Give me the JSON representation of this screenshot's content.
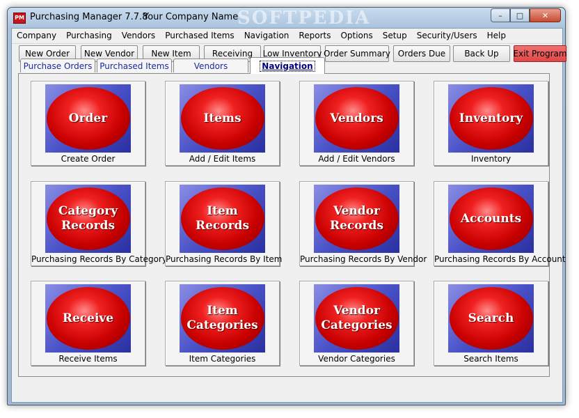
{
  "window": {
    "title": "Purchasing Manager 7.7.8",
    "company": "Your Company Name",
    "watermark": "SOFTPEDIA",
    "controls": {
      "minimize": "–",
      "maximize": "□",
      "close": "✕"
    }
  },
  "menu": [
    "Company",
    "Purchasing",
    "Vendors",
    "Purchased Items",
    "Navigation",
    "Reports",
    "Options",
    "Setup",
    "Security/Users",
    "Help"
  ],
  "toolbar": [
    "New Order",
    "New Vendor",
    "New Item",
    "Receiving",
    "Low Inventory",
    "Order Summary",
    "Orders Due",
    "Back Up",
    "Exit Program"
  ],
  "tabs": [
    "Purchase Orders",
    "Purchased Items",
    "Vendors",
    "Navigation"
  ],
  "active_tab": "Navigation",
  "colors": {
    "accent_exit": "#e85050",
    "tile_blue": "#4a52c8",
    "ball_red": "#e01010"
  },
  "cards": [
    {
      "tile": "Order",
      "label": "Create  Order"
    },
    {
      "tile": "Items",
      "label": "Add / Edit Items"
    },
    {
      "tile": "Vendors",
      "label": "Add / Edit Vendors"
    },
    {
      "tile": "Inventory",
      "label": "Inventory"
    },
    {
      "tile": "Category Records",
      "label": "Purchasing Records By Category"
    },
    {
      "tile": "Item Records",
      "label": "Purchasing Records By Item"
    },
    {
      "tile": "Vendor Records",
      "label": "Purchasing Records By Vendor"
    },
    {
      "tile": "Accounts",
      "label": "Purchasing Records By Account"
    },
    {
      "tile": "Receive",
      "label": "Receive Items"
    },
    {
      "tile": "Item Categories",
      "label": "Item Categories"
    },
    {
      "tile": "Vendor Categories",
      "label": "Vendor Categories"
    },
    {
      "tile": "Search",
      "label": "Search Items"
    }
  ]
}
